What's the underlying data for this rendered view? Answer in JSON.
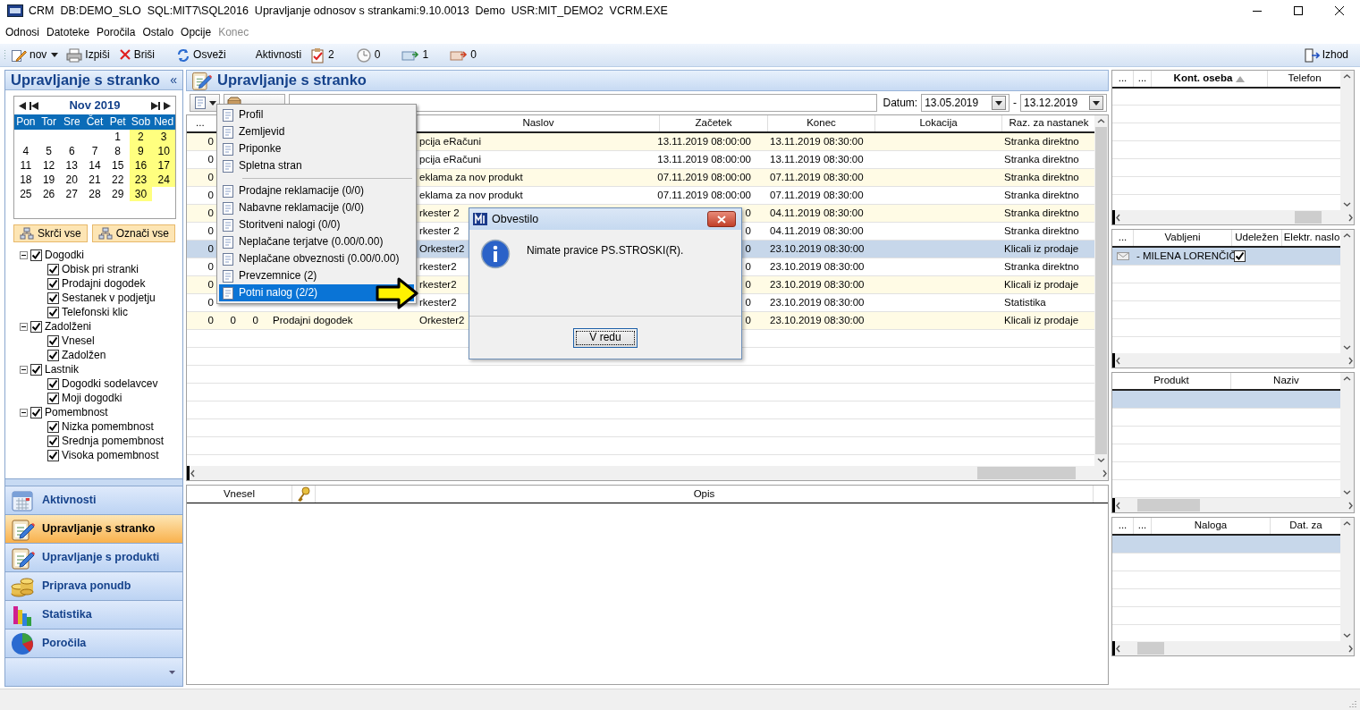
{
  "window": {
    "title": "CRM  DB:DEMO_SLO  SQL:MIT7\\SQL2016  Upravljanje odnosov s strankami:9.10.0013  Demo  USR:MIT_DEMO2  VCRM.EXE"
  },
  "menu": [
    {
      "label": "Odnosi",
      "disabled": false
    },
    {
      "label": "Datoteke",
      "disabled": false
    },
    {
      "label": "Poročila",
      "disabled": false
    },
    {
      "label": "Ostalo",
      "disabled": false
    },
    {
      "label": "Opcije",
      "disabled": false
    },
    {
      "label": "Konec",
      "disabled": true
    }
  ],
  "toolbar": {
    "buttons": [
      {
        "kind": "new",
        "label": "nov",
        "dropdown": true
      },
      {
        "kind": "print",
        "label": "Izpiši"
      },
      {
        "kind": "delete",
        "label": "Briši"
      },
      {
        "kind": "refresh",
        "label": "Osveži"
      }
    ],
    "activities_label": "Aktivnosti",
    "counters": [
      {
        "kind": "tasks",
        "value": "2"
      },
      {
        "kind": "clock",
        "value": "0"
      },
      {
        "kind": "incoming",
        "value": "1"
      },
      {
        "kind": "outgoing",
        "value": "0"
      }
    ],
    "exit": {
      "label": "Izhod"
    }
  },
  "sidebar": {
    "title": "Upravljanje s stranko",
    "collapse": "«",
    "calendar": {
      "month": "Nov 2019",
      "weekdays": [
        "Pon",
        "Tor",
        "Sre",
        "Čet",
        "Pet",
        "Sob",
        "Ned"
      ],
      "weeks": [
        {
          "days": [
            {
              "day": "1",
              "highlighted": false
            },
            {
              "day": "2",
              "highlighted": true
            },
            {
              "day": "3",
              "highlighted": true
            }
          ]
        },
        {
          "days": [
            {
              "day": "4",
              "highlighted": false
            },
            {
              "day": "5",
              "highlighted": false
            },
            {
              "day": "6",
              "highlighted": false
            },
            {
              "day": "7",
              "highlighted": false
            },
            {
              "day": "8",
              "highlighted": false
            },
            {
              "day": "9",
              "highlighted": true
            },
            {
              "day": "10",
              "highlighted": true
            }
          ]
        },
        {
          "days": [
            {
              "day": "11",
              "highlighted": false
            },
            {
              "day": "12",
              "highlighted": false
            },
            {
              "day": "13",
              "highlighted": false
            },
            {
              "day": "14",
              "highlighted": false
            },
            {
              "day": "15",
              "highlighted": false
            },
            {
              "day": "16",
              "highlighted": true
            },
            {
              "day": "17",
              "highlighted": true
            }
          ]
        },
        {
          "days": [
            {
              "day": "18",
              "highlighted": false
            },
            {
              "day": "19",
              "highlighted": false
            },
            {
              "day": "20",
              "highlighted": false
            },
            {
              "day": "21",
              "highlighted": false
            },
            {
              "day": "22",
              "highlighted": false
            },
            {
              "day": "23",
              "highlighted": true
            },
            {
              "day": "24",
              "highlighted": true
            }
          ]
        },
        {
          "days": [
            {
              "day": "25",
              "highlighted": false
            },
            {
              "day": "26",
              "highlighted": false
            },
            {
              "day": "27",
              "highlighted": false
            },
            {
              "day": "28",
              "highlighted": false
            },
            {
              "day": "29",
              "highlighted": false
            },
            {
              "day": "30",
              "highlighted": true
            }
          ]
        }
      ]
    },
    "buttons": [
      "Skrči vse",
      "Označi vse"
    ],
    "tree": [
      {
        "label": "Dogodki",
        "checked": true,
        "expanded": true,
        "children": [
          {
            "label": "Obisk pri stranki",
            "checked": true
          },
          {
            "label": "Prodajni dogodek",
            "checked": true
          },
          {
            "label": "Sestanek v podjetju",
            "checked": true
          },
          {
            "label": "Telefonski klic",
            "checked": true
          }
        ]
      },
      {
        "label": "Zadolženi",
        "checked": true,
        "expanded": true,
        "children": [
          {
            "label": "Vnesel",
            "checked": true
          },
          {
            "label": "Zadolžen",
            "checked": true
          }
        ]
      },
      {
        "label": "Lastnik",
        "checked": true,
        "expanded": true,
        "children": [
          {
            "label": "Dogodki sodelavcev",
            "checked": true
          },
          {
            "label": "Moji dogodki",
            "checked": true
          }
        ]
      },
      {
        "label": "Pomembnost",
        "checked": true,
        "expanded": true,
        "children": [
          {
            "label": "Nizka pomembnost",
            "checked": true
          },
          {
            "label": "Srednja pomembnost",
            "checked": true
          },
          {
            "label": "Visoka pomembnost",
            "checked": true
          }
        ]
      }
    ],
    "nav": [
      {
        "label": "Aktivnosti",
        "kind": "calendar",
        "selected": false
      },
      {
        "label": "Upravljanje s stranko",
        "kind": "clipboard",
        "selected": true
      },
      {
        "label": "Upravljanje s produkti",
        "kind": "clipboard",
        "selected": false
      },
      {
        "label": "Priprava ponudb",
        "kind": "coins",
        "selected": false
      },
      {
        "label": "Statistika",
        "kind": "chart",
        "selected": false
      },
      {
        "label": "Poročila",
        "kind": "pie",
        "selected": false
      }
    ]
  },
  "main": {
    "title": "Upravljanje s stranko",
    "date_label": "Datum:",
    "date_from": "13.05.2019",
    "date_separator": "-",
    "date_to": "13.12.2019",
    "table": {
      "columns": {
        "column_1": "...",
        "naslov": "Naslov",
        "zacetek": "Začetek",
        "konec": "Konec",
        "lokacija": "Lokacija",
        "raz": "Raz. za nastanek"
      },
      "rows": [
        {
          "column_1": "0",
          "naslov": "pcija eRačuni",
          "zacetek": "13.11.2019 08:00:00",
          "konec": "13.11.2019 08:30:00",
          "raz": "Stranka direktno",
          "selected": false
        },
        {
          "column_1": "0",
          "naslov": "pcija eRačuni",
          "zacetek": "13.11.2019 08:00:00",
          "konec": "13.11.2019 08:30:00",
          "raz": "Stranka direktno",
          "selected": false
        },
        {
          "column_1": "0",
          "naslov": "eklama za nov produkt",
          "zacetek": "07.11.2019 08:00:00",
          "konec": "07.11.2019 08:30:00",
          "raz": "Stranka direktno",
          "selected": false
        },
        {
          "column_1": "0",
          "naslov": "eklama za nov produkt",
          "zacetek": "07.11.2019 08:00:00",
          "konec": "07.11.2019 08:30:00",
          "raz": "Stranka direktno",
          "selected": false
        },
        {
          "column_1": "0",
          "naslov": "rkester 2",
          "zacetek": "0",
          "konec": "04.11.2019 08:30:00",
          "raz": "Stranka direktno",
          "selected": false
        },
        {
          "column_1": "0",
          "naslov": "rkester 2",
          "zacetek": "0",
          "konec": "04.11.2019 08:30:00",
          "raz": "Stranka direktno",
          "selected": false
        },
        {
          "column_1": "0",
          "naslov": "Orkester2",
          "zacetek": "0",
          "konec": "23.10.2019 08:30:00",
          "raz": "Klicali iz prodaje",
          "selected": true
        },
        {
          "column_1": "0",
          "naslov": "rkester2",
          "zacetek": "0",
          "konec": "23.10.2019 08:30:00",
          "raz": "Stranka direktno",
          "selected": false
        },
        {
          "column_1": "0",
          "naslov": "rkester2",
          "zacetek": "0",
          "konec": "23.10.2019 08:30:00",
          "raz": "Klicali iz prodaje",
          "selected": false
        },
        {
          "column_1": "0",
          "naslov": "rkester2",
          "zacetek": "0",
          "konec": "23.10.2019 08:30:00",
          "raz": "Statistika",
          "selected": false
        },
        {
          "column_1": "0",
          "column_2": "0",
          "column_3": "0",
          "column_4": "Prodajni dogodek",
          "naslov": "Orkester2",
          "zacetek": "0",
          "konec": "23.10.2019 08:30:00",
          "raz": "Klicali iz prodaje",
          "selected": false
        }
      ]
    },
    "notes": {
      "columns": [
        {
          "kind": "text",
          "label": "Vnesel"
        },
        {
          "kind": "key"
        },
        {
          "kind": "text",
          "label": "Opis"
        }
      ]
    }
  },
  "right": {
    "contacts": {
      "columns": [
        {
          "label": "..."
        },
        {
          "label": "..."
        },
        {
          "label": "Kont. oseba",
          "sorted": true
        },
        {
          "label": "Telefon"
        }
      ]
    },
    "invitees": {
      "columns": [
        {
          "label": "..."
        },
        {
          "label": "Vabljeni"
        },
        {
          "label": "Udeležen"
        },
        {
          "label": "Elektr. naslo"
        }
      ],
      "rows": [
        {
          "name": "- MILENA LORENČIČ",
          "attended": true,
          "selected": true
        }
      ]
    },
    "products": {
      "columns": [
        {
          "label": "Produkt"
        },
        {
          "label": "Naziv"
        }
      ],
      "rows": [
        {
          "selected": true
        }
      ]
    },
    "orders": {
      "columns": [
        {
          "label": "..."
        },
        {
          "label": "..."
        },
        {
          "label": "Naloga"
        },
        {
          "label": "Dat. za"
        }
      ],
      "rows": [
        {
          "selected": true
        }
      ]
    }
  },
  "context_menu": {
    "groups": [
      {
        "items": [
          {
            "label": "Profil",
            "selected": false
          },
          {
            "label": "Zemljevid",
            "selected": false
          },
          {
            "label": "Priponke",
            "selected": false
          },
          {
            "label": "Spletna stran",
            "selected": false
          }
        ]
      },
      {
        "items": [
          {
            "label": "Prodajne reklamacije (0/0)",
            "selected": false
          },
          {
            "label": "Nabavne reklamacije (0/0)",
            "selected": false
          },
          {
            "label": "Storitveni nalogi (0/0)",
            "selected": false
          },
          {
            "label": "Neplačane terjatve (0.00/0.00)",
            "selected": false
          },
          {
            "label": "Neplačane obveznosti (0.00/0.00)",
            "selected": false
          },
          {
            "label": "Prevzemnice (2)",
            "selected": false
          },
          {
            "label": "Potni nalog (2/2)",
            "selected": true
          }
        ]
      }
    ]
  },
  "dialog": {
    "title": "Obvestilo",
    "message": "Nimate pravice PS.STROSKI(R).",
    "button": "V redu"
  }
}
